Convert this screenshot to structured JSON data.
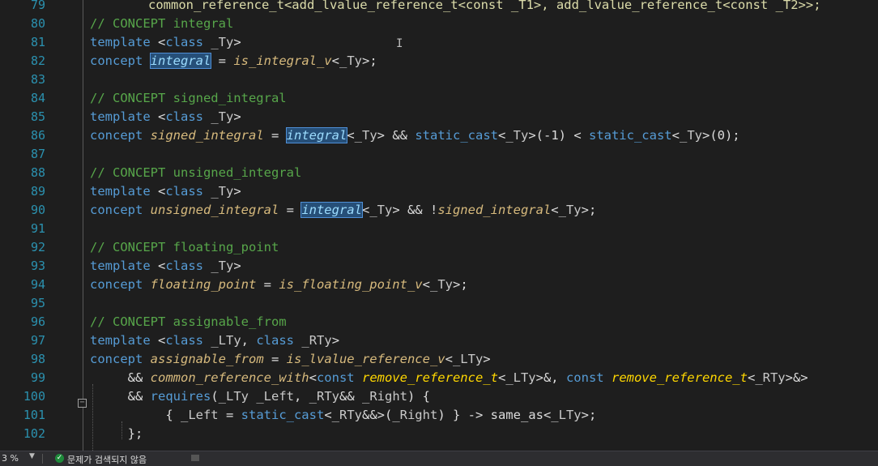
{
  "editor": {
    "cut_top_line": {
      "number": "79",
      "text": "common_reference_t<add_lvalue_reference_t<const _T1>, add_lvalue_reference_t<const _T2>>;"
    },
    "lines": [
      {
        "n": "80",
        "tokens": [
          [
            "cm",
            "// CONCEPT integral"
          ]
        ]
      },
      {
        "n": "81",
        "tokens": [
          [
            "kw",
            "template"
          ],
          [
            "p",
            " <"
          ],
          [
            "kw",
            "class"
          ],
          [
            "p",
            " "
          ],
          [
            "tp",
            "_Ty"
          ],
          [
            "p",
            ">"
          ]
        ]
      },
      {
        "n": "82",
        "tokens": [
          [
            "kw",
            "concept"
          ],
          [
            "p",
            " "
          ],
          [
            "hl",
            "integral"
          ],
          [
            "p",
            " = "
          ],
          [
            "cn",
            "is_integral_v"
          ],
          [
            "p",
            "<"
          ],
          [
            "tp",
            "_Ty"
          ],
          [
            "p",
            ">;"
          ]
        ]
      },
      {
        "n": "83",
        "tokens": []
      },
      {
        "n": "84",
        "tokens": [
          [
            "cm",
            "// CONCEPT signed_integral"
          ]
        ]
      },
      {
        "n": "85",
        "tokens": [
          [
            "kw",
            "template"
          ],
          [
            "p",
            " <"
          ],
          [
            "kw",
            "class"
          ],
          [
            "p",
            " "
          ],
          [
            "tp",
            "_Ty"
          ],
          [
            "p",
            ">"
          ]
        ]
      },
      {
        "n": "86",
        "tokens": [
          [
            "kw",
            "concept"
          ],
          [
            "p",
            " "
          ],
          [
            "cn",
            "signed_integral"
          ],
          [
            "p",
            " = "
          ],
          [
            "hl",
            "integral"
          ],
          [
            "p",
            "<"
          ],
          [
            "tp",
            "_Ty"
          ],
          [
            "p",
            "> && "
          ],
          [
            "kw",
            "static_cast"
          ],
          [
            "p",
            "<"
          ],
          [
            "tp",
            "_Ty"
          ],
          [
            "p",
            ">(-1) < "
          ],
          [
            "kw",
            "static_cast"
          ],
          [
            "p",
            "<"
          ],
          [
            "tp",
            "_Ty"
          ],
          [
            "p",
            ">(0);"
          ]
        ]
      },
      {
        "n": "87",
        "tokens": []
      },
      {
        "n": "88",
        "tokens": [
          [
            "cm",
            "// CONCEPT unsigned_integral"
          ]
        ]
      },
      {
        "n": "89",
        "tokens": [
          [
            "kw",
            "template"
          ],
          [
            "p",
            " <"
          ],
          [
            "kw",
            "class"
          ],
          [
            "p",
            " "
          ],
          [
            "tp",
            "_Ty"
          ],
          [
            "p",
            ">"
          ]
        ]
      },
      {
        "n": "90",
        "tokens": [
          [
            "kw",
            "concept"
          ],
          [
            "p",
            " "
          ],
          [
            "cn",
            "unsigned_integral"
          ],
          [
            "p",
            " = "
          ],
          [
            "hl",
            "integral"
          ],
          [
            "p",
            "<"
          ],
          [
            "tp",
            "_Ty"
          ],
          [
            "p",
            "> && !"
          ],
          [
            "cn",
            "signed_integral"
          ],
          [
            "p",
            "<"
          ],
          [
            "tp",
            "_Ty"
          ],
          [
            "p",
            ">;"
          ]
        ]
      },
      {
        "n": "91",
        "tokens": []
      },
      {
        "n": "92",
        "tokens": [
          [
            "cm",
            "// CONCEPT floating_point"
          ]
        ]
      },
      {
        "n": "93",
        "tokens": [
          [
            "kw",
            "template"
          ],
          [
            "p",
            " <"
          ],
          [
            "kw",
            "class"
          ],
          [
            "p",
            " "
          ],
          [
            "tp",
            "_Ty"
          ],
          [
            "p",
            ">"
          ]
        ]
      },
      {
        "n": "94",
        "tokens": [
          [
            "kw",
            "concept"
          ],
          [
            "p",
            " "
          ],
          [
            "cn",
            "floating_point"
          ],
          [
            "p",
            " = "
          ],
          [
            "cn",
            "is_floating_point_v"
          ],
          [
            "p",
            "<"
          ],
          [
            "tp",
            "_Ty"
          ],
          [
            "p",
            ">;"
          ]
        ]
      },
      {
        "n": "95",
        "tokens": []
      },
      {
        "n": "96",
        "tokens": [
          [
            "cm",
            "// CONCEPT assignable_from"
          ]
        ]
      },
      {
        "n": "97",
        "tokens": [
          [
            "kw",
            "template"
          ],
          [
            "p",
            " <"
          ],
          [
            "kw",
            "class"
          ],
          [
            "p",
            " "
          ],
          [
            "tp",
            "_LTy"
          ],
          [
            "p",
            ", "
          ],
          [
            "kw",
            "class"
          ],
          [
            "p",
            " "
          ],
          [
            "tp",
            "_RTy"
          ],
          [
            "p",
            ">"
          ]
        ]
      },
      {
        "n": "98",
        "tokens": [
          [
            "kw",
            "concept"
          ],
          [
            "p",
            " "
          ],
          [
            "cn",
            "assignable_from"
          ],
          [
            "p",
            " = "
          ],
          [
            "cn",
            "is_lvalue_reference_v"
          ],
          [
            "p",
            "<"
          ],
          [
            "tp",
            "_LTy"
          ],
          [
            "p",
            ">"
          ]
        ]
      },
      {
        "n": "99",
        "tokens": [
          [
            "p",
            "     && "
          ],
          [
            "cn",
            "common_reference_with"
          ],
          [
            "p",
            "<"
          ],
          [
            "kw",
            "const"
          ],
          [
            "p",
            " "
          ],
          [
            "fn",
            "remove_reference_t"
          ],
          [
            "p",
            "<"
          ],
          [
            "tp",
            "_LTy"
          ],
          [
            "p",
            ">&, "
          ],
          [
            "kw",
            "const"
          ],
          [
            "p",
            " "
          ],
          [
            "fn",
            "remove_reference_t"
          ],
          [
            "p",
            "<"
          ],
          [
            "tp",
            "_RTy"
          ],
          [
            "p",
            ">&>"
          ]
        ]
      },
      {
        "n": "100",
        "tokens": [
          [
            "p",
            "     && "
          ],
          [
            "kw",
            "requires"
          ],
          [
            "p",
            "("
          ],
          [
            "tp",
            "_LTy"
          ],
          [
            "p",
            " "
          ],
          [
            "tp",
            "_Left"
          ],
          [
            "p",
            ", "
          ],
          [
            "tp",
            "_RTy"
          ],
          [
            "p",
            "&& "
          ],
          [
            "tp",
            "_Right"
          ],
          [
            "p",
            ") {"
          ]
        ]
      },
      {
        "n": "101",
        "tokens": [
          [
            "p",
            "          { "
          ],
          [
            "tp",
            "_Left"
          ],
          [
            "p",
            " = "
          ],
          [
            "kw",
            "static_cast"
          ],
          [
            "p",
            "<"
          ],
          [
            "tp",
            "_RTy"
          ],
          [
            "p",
            "&&>("
          ],
          [
            "tp",
            "_Right"
          ],
          [
            "p",
            ") } -> same_as<"
          ],
          [
            "tp",
            "_LTy"
          ],
          [
            "p",
            ">;"
          ]
        ]
      },
      {
        "n": "102",
        "tokens": [
          [
            "p",
            "     };"
          ]
        ]
      }
    ]
  },
  "status_bar": {
    "zoom": "3 %",
    "issues_text": "문제가 검색되지 않음",
    "ok_icon": "check-circle-icon"
  },
  "colors": {
    "background": "#1e1e1e",
    "line_number": "#2b91af",
    "keyword": "#569cd6",
    "comment": "#57a64a",
    "concept": "#d7ba7d",
    "function": "#ffd700",
    "highlight": "#264f78"
  }
}
